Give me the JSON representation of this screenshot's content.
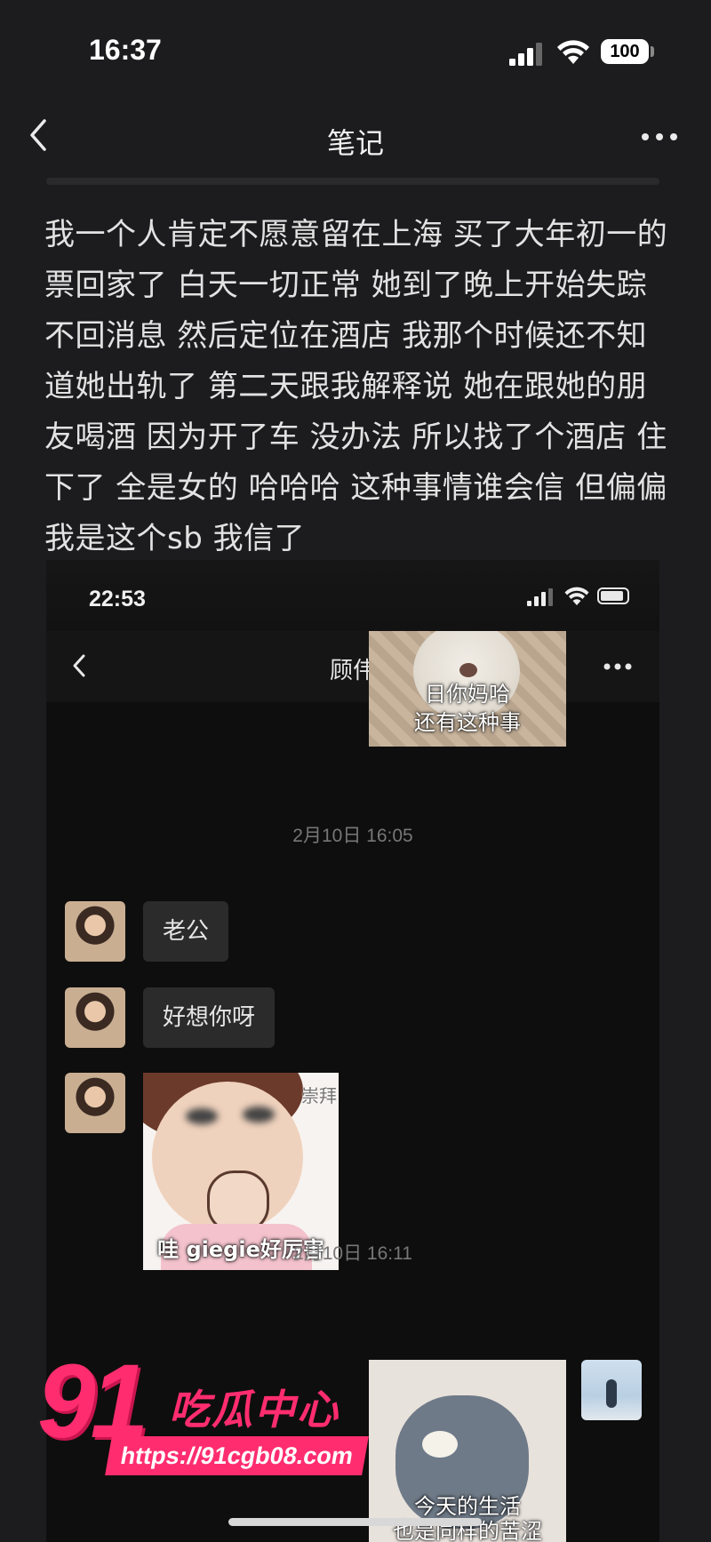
{
  "status_bar": {
    "time": "16:37",
    "battery": "100"
  },
  "nav": {
    "title": "笔记"
  },
  "note": {
    "text": "我一个人肯定不愿意留在上海 买了大年初一的票回家了 白天一切正常 她到了晚上开始失踪 不回消息 然后定位在酒店 我那个时候还不知道她出轨了 第二天跟我解释说 她在跟她的朋友喝酒 因为开了车 没办法 所以找了个酒店 住下了  全是女的 哈哈哈 这种事情谁会信 但偏偏我是这个sb 我信了"
  },
  "screenshot": {
    "status_time": "22:53",
    "chat_title": "顾伟",
    "sticker_top_caption_1": "日你妈哈",
    "sticker_top_caption_2": "还有这种事",
    "timestamp_1": "2月10日 16:05",
    "messages": [
      {
        "text": "老公"
      },
      {
        "text": "好想你呀"
      }
    ],
    "sticker_face_caption": "哇 giegie好厉害",
    "sticker_face_corner": "崇拜",
    "timestamp_2": "2月10日 16:11",
    "sticker_tom_caption_1": "今天的生活",
    "sticker_tom_caption_2": "也是同样的苦涩"
  },
  "watermark": {
    "number": "91",
    "brand": "吃瓜中心",
    "url": "https://91cgb08.com"
  },
  "colors": {
    "background": "#1c1c1e",
    "watermark": "#ff2d6f",
    "bubble": "#2b2b2b"
  }
}
